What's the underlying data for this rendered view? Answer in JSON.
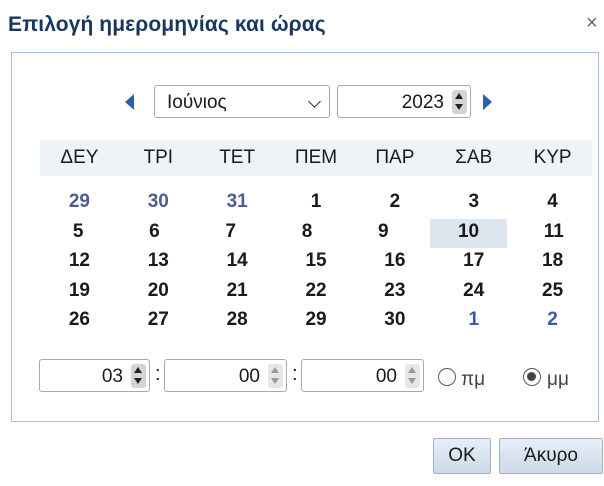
{
  "dialog": {
    "title": "Επιλογή ημερομηνίας και ώρας",
    "close_glyph": "×"
  },
  "nav": {
    "month": "Ιούνιος",
    "year": "2023",
    "prev_icon": "triangle-left-icon",
    "next_icon": "triangle-right-icon"
  },
  "weekdays": [
    "ΔΕΥ",
    "ΤΡΙ",
    "ΤΕΤ",
    "ΠΕΜ",
    "ΠΑΡ",
    "ΣΑΒ",
    "ΚΥΡ"
  ],
  "weeks": [
    [
      {
        "d": "29",
        "m": "prev"
      },
      {
        "d": "30",
        "m": "prev"
      },
      {
        "d": "31",
        "m": "prev"
      },
      {
        "d": "1",
        "m": "cur"
      },
      {
        "d": "2",
        "m": "cur"
      },
      {
        "d": "3",
        "m": "cur"
      },
      {
        "d": "4",
        "m": "cur"
      }
    ],
    [
      {
        "d": "5",
        "m": "cur"
      },
      {
        "d": "6",
        "m": "cur"
      },
      {
        "d": "7",
        "m": "cur"
      },
      {
        "d": "8",
        "m": "cur"
      },
      {
        "d": "9",
        "m": "cur"
      },
      {
        "d": "10",
        "m": "cur",
        "selected": true
      },
      {
        "d": "11",
        "m": "cur"
      }
    ],
    [
      {
        "d": "12",
        "m": "cur"
      },
      {
        "d": "13",
        "m": "cur"
      },
      {
        "d": "14",
        "m": "cur"
      },
      {
        "d": "15",
        "m": "cur"
      },
      {
        "d": "16",
        "m": "cur"
      },
      {
        "d": "17",
        "m": "cur"
      },
      {
        "d": "18",
        "m": "cur"
      }
    ],
    [
      {
        "d": "19",
        "m": "cur"
      },
      {
        "d": "20",
        "m": "cur"
      },
      {
        "d": "21",
        "m": "cur"
      },
      {
        "d": "22",
        "m": "cur"
      },
      {
        "d": "23",
        "m": "cur"
      },
      {
        "d": "24",
        "m": "cur"
      },
      {
        "d": "25",
        "m": "cur"
      }
    ],
    [
      {
        "d": "26",
        "m": "cur"
      },
      {
        "d": "27",
        "m": "cur"
      },
      {
        "d": "28",
        "m": "cur"
      },
      {
        "d": "29",
        "m": "cur"
      },
      {
        "d": "30",
        "m": "cur"
      },
      {
        "d": "1",
        "m": "next"
      },
      {
        "d": "2",
        "m": "next"
      }
    ]
  ],
  "time": {
    "hours": "03",
    "minutes": "00",
    "seconds": "00",
    "separator": ":",
    "am_label": "πμ",
    "pm_label": "μμ",
    "selected_period": "pm"
  },
  "buttons": {
    "ok": "OK",
    "cancel": "Άκυρο"
  },
  "colors": {
    "title": "#17375e",
    "arrow": "#2a5fb0",
    "other_month_day": "#4d5e8c",
    "next_month_day": "#3c5aa6",
    "selected_day_bg": "#dde5ef",
    "weekday_header_bg": "#eef3f8",
    "panel_border": "#a9bed7"
  }
}
